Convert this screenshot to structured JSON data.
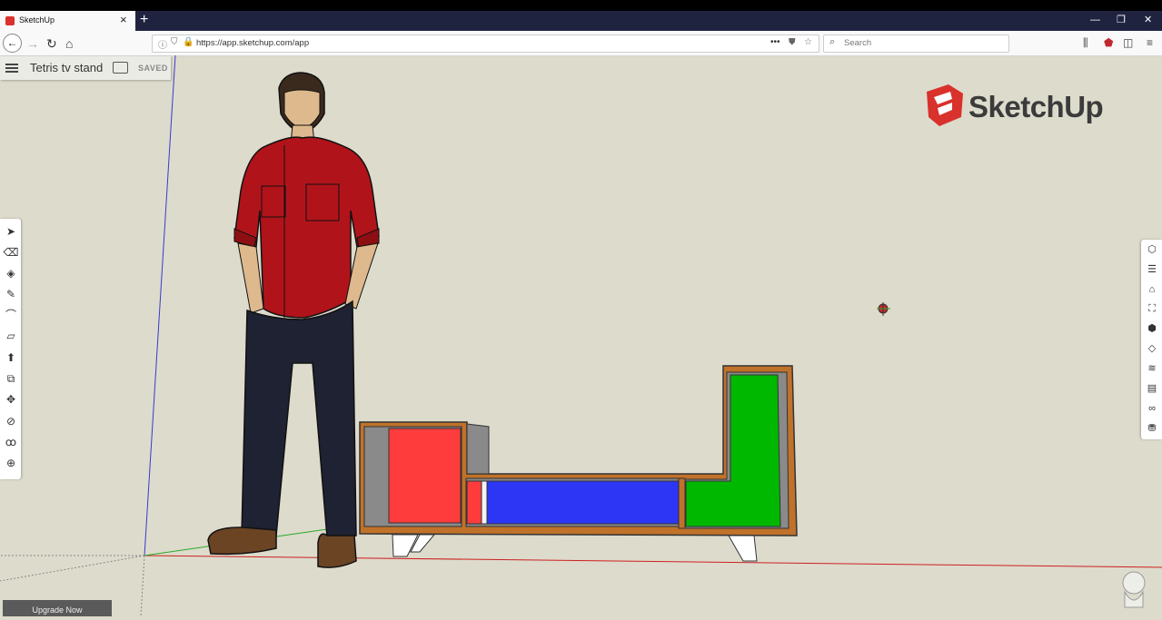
{
  "browser": {
    "tab_title": "SketchUp",
    "new_tab_label": "+",
    "url": "https://app.sketchup.com/app",
    "search_placeholder": "Search",
    "nav": {
      "back": "←",
      "forward": "→",
      "reload": "↻",
      "home": "⌂"
    }
  },
  "app": {
    "document_title": "Tetris tv stand",
    "save_status": "SAVED",
    "logo_text": "SketchUp",
    "upgrade_label": "Upgrade Now"
  },
  "left_toolbar": [
    {
      "name": "select-tool-icon",
      "glyph": "➤"
    },
    {
      "name": "eraser-tool-icon",
      "glyph": "⌫"
    },
    {
      "name": "paint-bucket-tool-icon",
      "glyph": "◈"
    },
    {
      "name": "pencil-tool-icon",
      "glyph": "✎"
    },
    {
      "name": "arc-tool-icon",
      "glyph": "⌒"
    },
    {
      "name": "rectangle-tool-icon",
      "glyph": "▱"
    },
    {
      "name": "push-pull-tool-icon",
      "glyph": "⬆"
    },
    {
      "name": "offset-tool-icon",
      "glyph": "⧉"
    },
    {
      "name": "move-tool-icon",
      "glyph": "✥"
    },
    {
      "name": "tape-measure-tool-icon",
      "glyph": "⊘"
    },
    {
      "name": "footprints-tool-icon",
      "glyph": "ꝏ"
    },
    {
      "name": "orbit-tool-icon",
      "glyph": "⊕"
    }
  ],
  "right_toolbar": [
    {
      "name": "entity-info-icon",
      "glyph": "⬡"
    },
    {
      "name": "outliner-icon",
      "glyph": "☰"
    },
    {
      "name": "instructor-icon",
      "glyph": "🎓"
    },
    {
      "name": "components-icon",
      "glyph": "⛶"
    },
    {
      "name": "materials-icon",
      "glyph": "⬢"
    },
    {
      "name": "styles-icon",
      "glyph": "◇"
    },
    {
      "name": "tags-icon",
      "glyph": "≋"
    },
    {
      "name": "scenes-icon",
      "glyph": "▤"
    },
    {
      "name": "display-icon",
      "glyph": "∞"
    },
    {
      "name": "3d-warehouse-icon",
      "glyph": "⛃"
    }
  ],
  "colors": {
    "canvas_bg": "#dddbcc",
    "shirt": "#b0141a",
    "jeans": "#1e2232",
    "cube_red": "#fe3c3c",
    "cube_blue": "#2c36f4",
    "cube_green": "#00b800",
    "wood": "#c0722a",
    "logo_red": "#d9312b"
  }
}
